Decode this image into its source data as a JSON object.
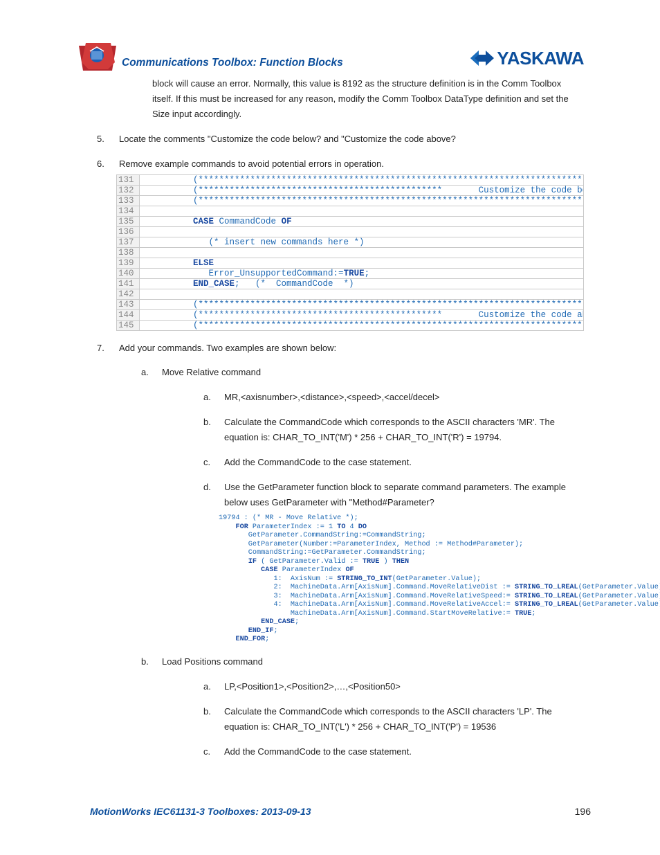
{
  "header": {
    "title": "Communications Toolbox: Function Blocks",
    "brand": "YASKAWA"
  },
  "intro": "block will cause an error.  Normally, this value is 8192 as the structure definition is in the Comm Toolbox itself.  If this must be increased for any reason, modify the Comm Toolbox DataType definition and set the Size input accordingly.",
  "item5": "Locate the comments \"Customize the code below? and \"Customize the code above?",
  "item6": "Remove example commands to avoid potential errors in operation.",
  "code1": {
    "start": 131,
    "lines": [
      "          (**************************************************************************************",
      "          (***********************************************       Customize the code below",
      "          (**************************************************************************************",
      "",
      "          CASE CommandCode OF",
      "",
      "             (* insert new commands here *)",
      "",
      "          ELSE",
      "             Error_UnsupportedCommand:=TRUE;",
      "          END_CASE;   (*  CommandCode  *)",
      "",
      "          (**************************************************************************************",
      "          (***********************************************       Customize the code above",
      "          (**************************************************************************************"
    ]
  },
  "item7": "Add your commands. Two examples are shown below:",
  "subA": {
    "title": "Move Relative command",
    "a": "MR,<axisnumber>,<distance>,<speed>,<accel/decel>",
    "b": "Calculate the CommandCode which corresponds to the ASCII characters 'MR'. The equation is: CHAR_TO_INT('M') * 256 + CHAR_TO_INT('R') = 19794.",
    "c": "Add the CommandCode to the case statement.",
    "d": "Use the GetParameter function block to separate command parameters. The example below uses GetParameter with \"Method#Parameter?"
  },
  "code2": "19794 : (* MR - Move Relative *);\n    FOR ParameterIndex := 1 TO 4 DO\n       GetParameter.CommandString:=CommandString;\n       GetParameter(Number:=ParameterIndex, Method := Method#Parameter);\n       CommandString:=GetParameter.CommandString;\n       IF ( GetParameter.Valid := TRUE ) THEN\n          CASE ParameterIndex OF\n             1:  AxisNum := STRING_TO_INT(GetParameter.Value);\n             2:  MachineData.Arm[AxisNum].Command.MoveRelativeDist := STRING_TO_LREAL(GetParameter.Value);\n             3:  MachineData.Arm[AxisNum].Command.MoveRelativeSpeed:= STRING_TO_LREAL(GetParameter.Value);\n             4:  MachineData.Arm[AxisNum].Command.MoveRelativeAccel:= STRING_TO_LREAL(GetParameter.Value);\n                 MachineData.Arm[AxisNum].Command.StartMoveRelative:= TRUE;\n          END_CASE;\n       END_IF;\n    END_FOR;",
  "subB": {
    "title": "Load Positions command",
    "a": "LP,<Position1>,<Position2>,…,<Position50>",
    "b": "Calculate the CommandCode which corresponds to the ASCII characters 'LP'. The equation is: CHAR_TO_INT('L') * 256 + CHAR_TO_INT('P') = 19536",
    "c": "Add the CommandCode to the case statement."
  },
  "footer": {
    "text": "MotionWorks IEC61131-3 Toolboxes: 2013-09-13",
    "page": "196"
  }
}
